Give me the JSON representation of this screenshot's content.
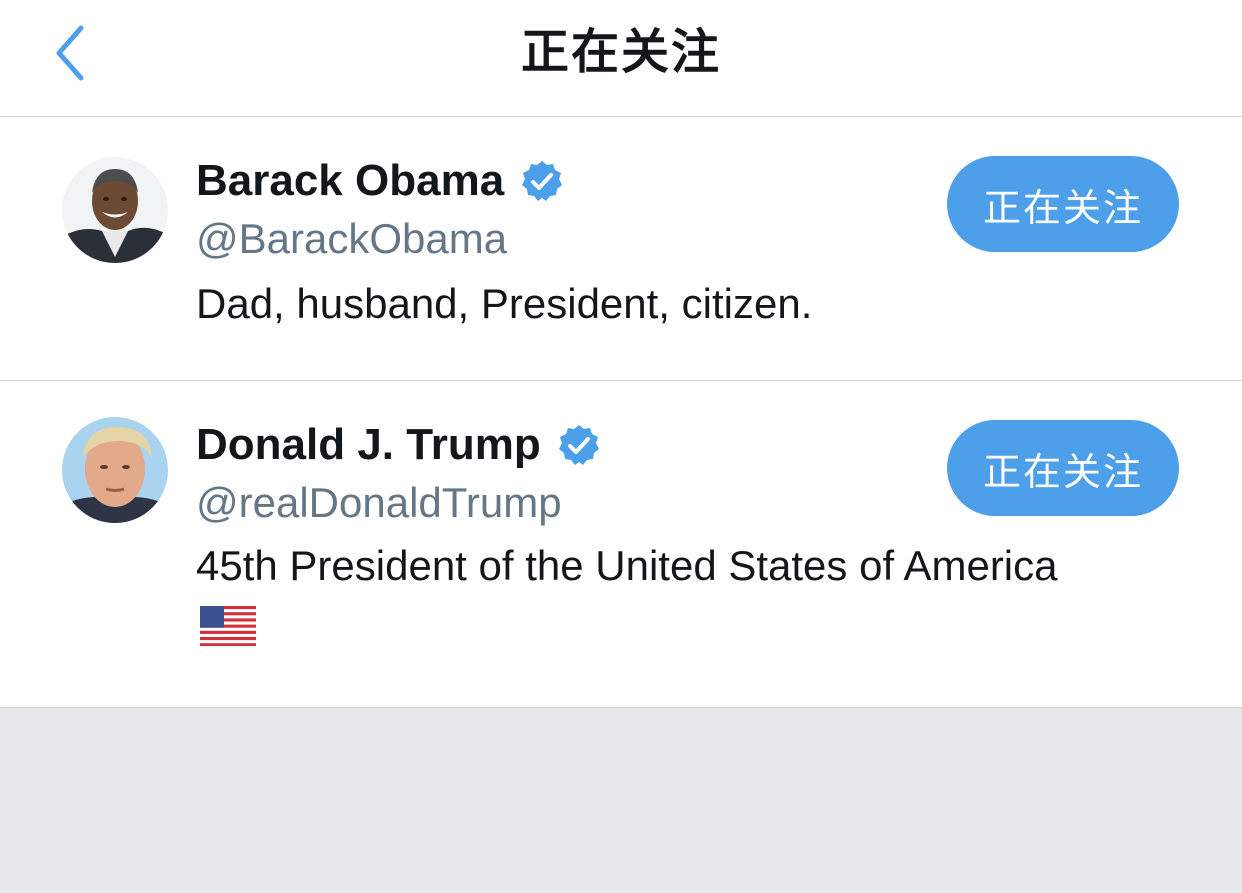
{
  "header": {
    "title": "正在关注",
    "back_icon": "chevron-left-icon"
  },
  "colors": {
    "accent": "#4d9fe9",
    "secondary_text": "#657786",
    "divider": "#cfd4d9",
    "empty_area": "#e6e9ed"
  },
  "users": [
    {
      "name": "Barack Obama",
      "handle": "@BarackObama",
      "bio": "Dad, husband, President, citizen.",
      "verified": true,
      "follow_label": "正在关注"
    },
    {
      "name": "Donald J. Trump",
      "handle": "@realDonaldTrump",
      "bio": "45th President of the United States of America",
      "bio_emoji": "us-flag-icon",
      "verified": true,
      "follow_label": "正在关注"
    }
  ]
}
